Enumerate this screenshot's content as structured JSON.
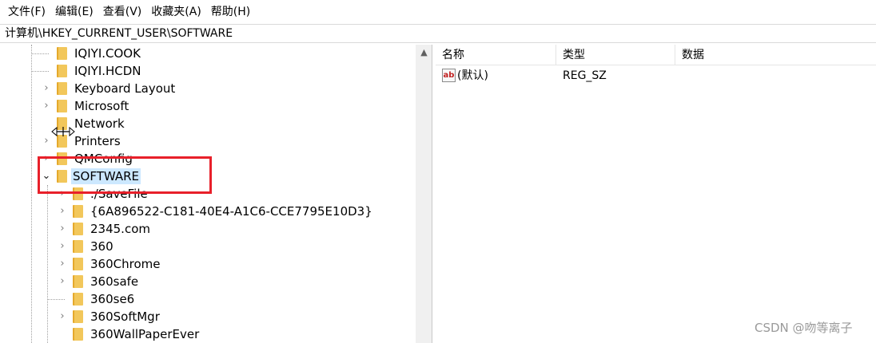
{
  "menubar": {
    "items": [
      {
        "label": "文件(F)"
      },
      {
        "label": "编辑(E)"
      },
      {
        "label": "查看(V)"
      },
      {
        "label": "收藏夹(A)"
      },
      {
        "label": "帮助(H)"
      }
    ]
  },
  "address": {
    "path": "计算机\\HKEY_CURRENT_USER\\SOFTWARE"
  },
  "tree": {
    "items": [
      {
        "label": "IQIYI.COOK"
      },
      {
        "label": "IQIYI.HCDN"
      },
      {
        "label": "Keyboard Layout"
      },
      {
        "label": "Microsoft"
      },
      {
        "label": "Network"
      },
      {
        "label": "Printers"
      },
      {
        "label": "QMConfig"
      },
      {
        "label": "SOFTWARE"
      },
      {
        "label": "./SaveFile"
      },
      {
        "label": "{6A896522-C181-40E4-A1C6-CCE7795E10D3}"
      },
      {
        "label": "2345.com"
      },
      {
        "label": "360"
      },
      {
        "label": "360Chrome"
      },
      {
        "label": "360safe"
      },
      {
        "label": "360se6"
      },
      {
        "label": "360SoftMgr"
      },
      {
        "label": "360WallPaperEver"
      }
    ]
  },
  "details": {
    "columns": [
      {
        "label": "名称"
      },
      {
        "label": "类型"
      },
      {
        "label": "数据"
      }
    ],
    "rows": [
      {
        "name": "(默认)",
        "type": "REG_SZ",
        "data": ""
      }
    ]
  },
  "watermark": {
    "text": "CSDN @吻等离子"
  },
  "colors": {
    "highlight_box": "#e8202a",
    "selection": "#cce8ff",
    "folder": "#f2c75b"
  }
}
